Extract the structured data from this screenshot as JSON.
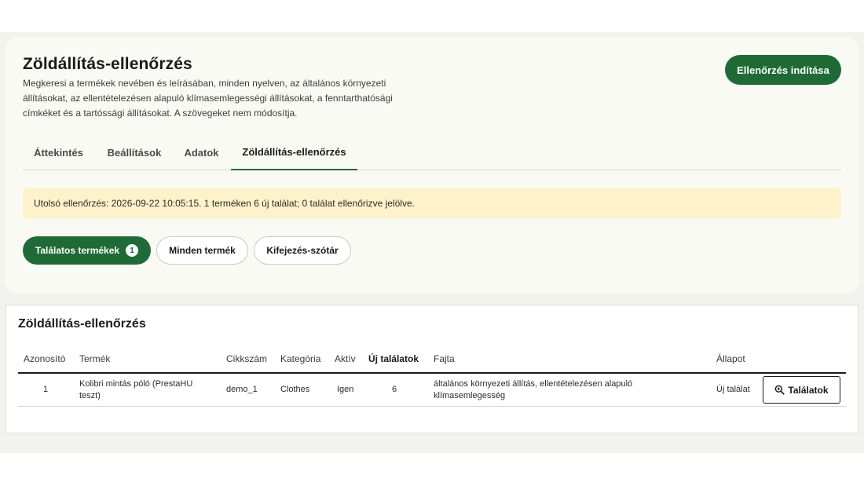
{
  "header": {
    "title": "Zöldállítás-ellenőrzés",
    "description": "Megkeresi a termékek nevében és leírásában, minden nyelven, az általános környezeti állításokat, az ellentételezésen alapuló klímasemlegességi állításokat, a fenntarthatósági címkéket és a tartóssági állításokat. A szövegeket nem módosítja.",
    "start_button": "Ellenőrzés indítása"
  },
  "tabs": [
    {
      "label": "Áttekintés"
    },
    {
      "label": "Beállítások"
    },
    {
      "label": "Adatok"
    },
    {
      "label": "Zöldállítás-ellenőrzés",
      "active": true
    }
  ],
  "notice": "Utolsó ellenőrzés: 2026-09-22 10:05:15. 1 terméken 6 új találat; 0 találat ellenőrizve jelölve.",
  "filters": [
    {
      "label": "Találatos termékek",
      "count": "1",
      "selected": true
    },
    {
      "label": "Minden termék"
    },
    {
      "label": "Kifejezés-szótár"
    }
  ],
  "table": {
    "title": "Zöldállítás-ellenőrzés",
    "columns": [
      "Azonosító",
      "Termék",
      "Cikkszám",
      "Kategória",
      "Aktív",
      "Új találatok",
      "Fajta",
      "Állapot"
    ],
    "rows": [
      {
        "id": "1",
        "product": "Kolibri mintás póló (PrestaHU teszt)",
        "sku": "demo_1",
        "category": "Clothes",
        "active": "Igen",
        "new_hits": "6",
        "type": "általános környezeti állítás, ellentételezésen alapuló klímasemlegesség",
        "status": "Új találat",
        "action": "Találatok"
      }
    ]
  },
  "colors": {
    "primary": "#1f6b35",
    "notice_bg": "#fdf2c9",
    "page_bg": "#f2f2ef",
    "card_bg": "#fafaf5"
  }
}
